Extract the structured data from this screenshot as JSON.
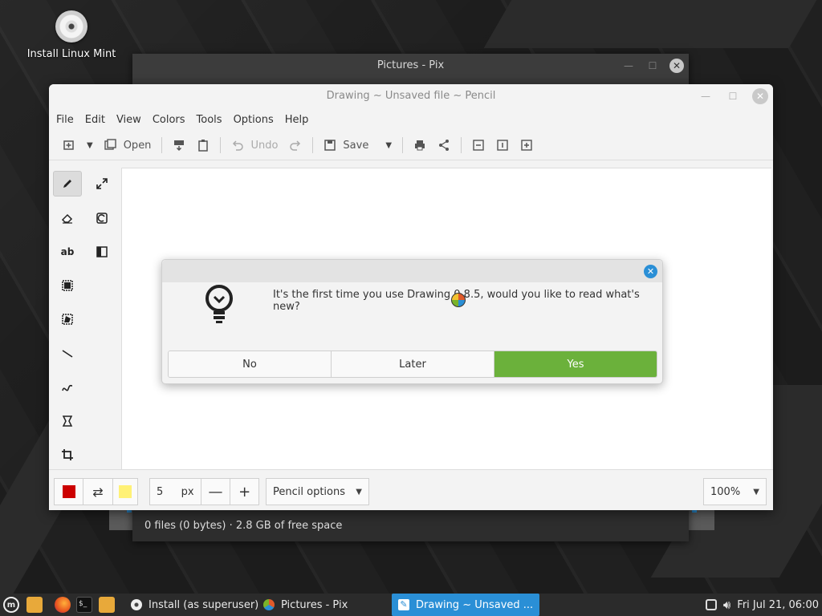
{
  "desktop": {
    "icon_label": "Install Linux Mint"
  },
  "pix_window": {
    "title": "Pictures - Pix",
    "status": "0 files (0 bytes) · 2.8 GB of free space"
  },
  "drawing_window": {
    "title": "Drawing ~ Unsaved file ~ Pencil",
    "menu": [
      "File",
      "Edit",
      "View",
      "Colors",
      "Tools",
      "Options",
      "Help"
    ],
    "toolbar": {
      "open_label": "Open",
      "undo_label": "Undo",
      "save_label": "Save"
    },
    "tools": [
      "pencil",
      "fullscreen",
      "eraser",
      "rotate",
      "text",
      "filter",
      "rect-select",
      "free-select",
      "line",
      "curve",
      "skew",
      "crop"
    ],
    "bottom": {
      "left_color": "#cc0000",
      "right_color": "#fff176",
      "size_value": "5",
      "size_unit": "px",
      "options_label": "Pencil options",
      "zoom_label": "100%"
    }
  },
  "dialog": {
    "message": "It's the first time you use Drawing 0.8.5, would you like to read what's new?",
    "buttons": [
      "No",
      "Later",
      "Yes"
    ]
  },
  "taskbar": {
    "windows": [
      {
        "label": "Install (as superuser)",
        "active": false
      },
      {
        "label": "Pictures - Pix",
        "active": false
      },
      {
        "label": "Drawing ~ Unsaved ...",
        "active": true
      }
    ],
    "clock": "Fri Jul 21, 06:00"
  },
  "colors": {
    "accent": "#2a8fd6",
    "yes_button": "#6bb13b"
  }
}
